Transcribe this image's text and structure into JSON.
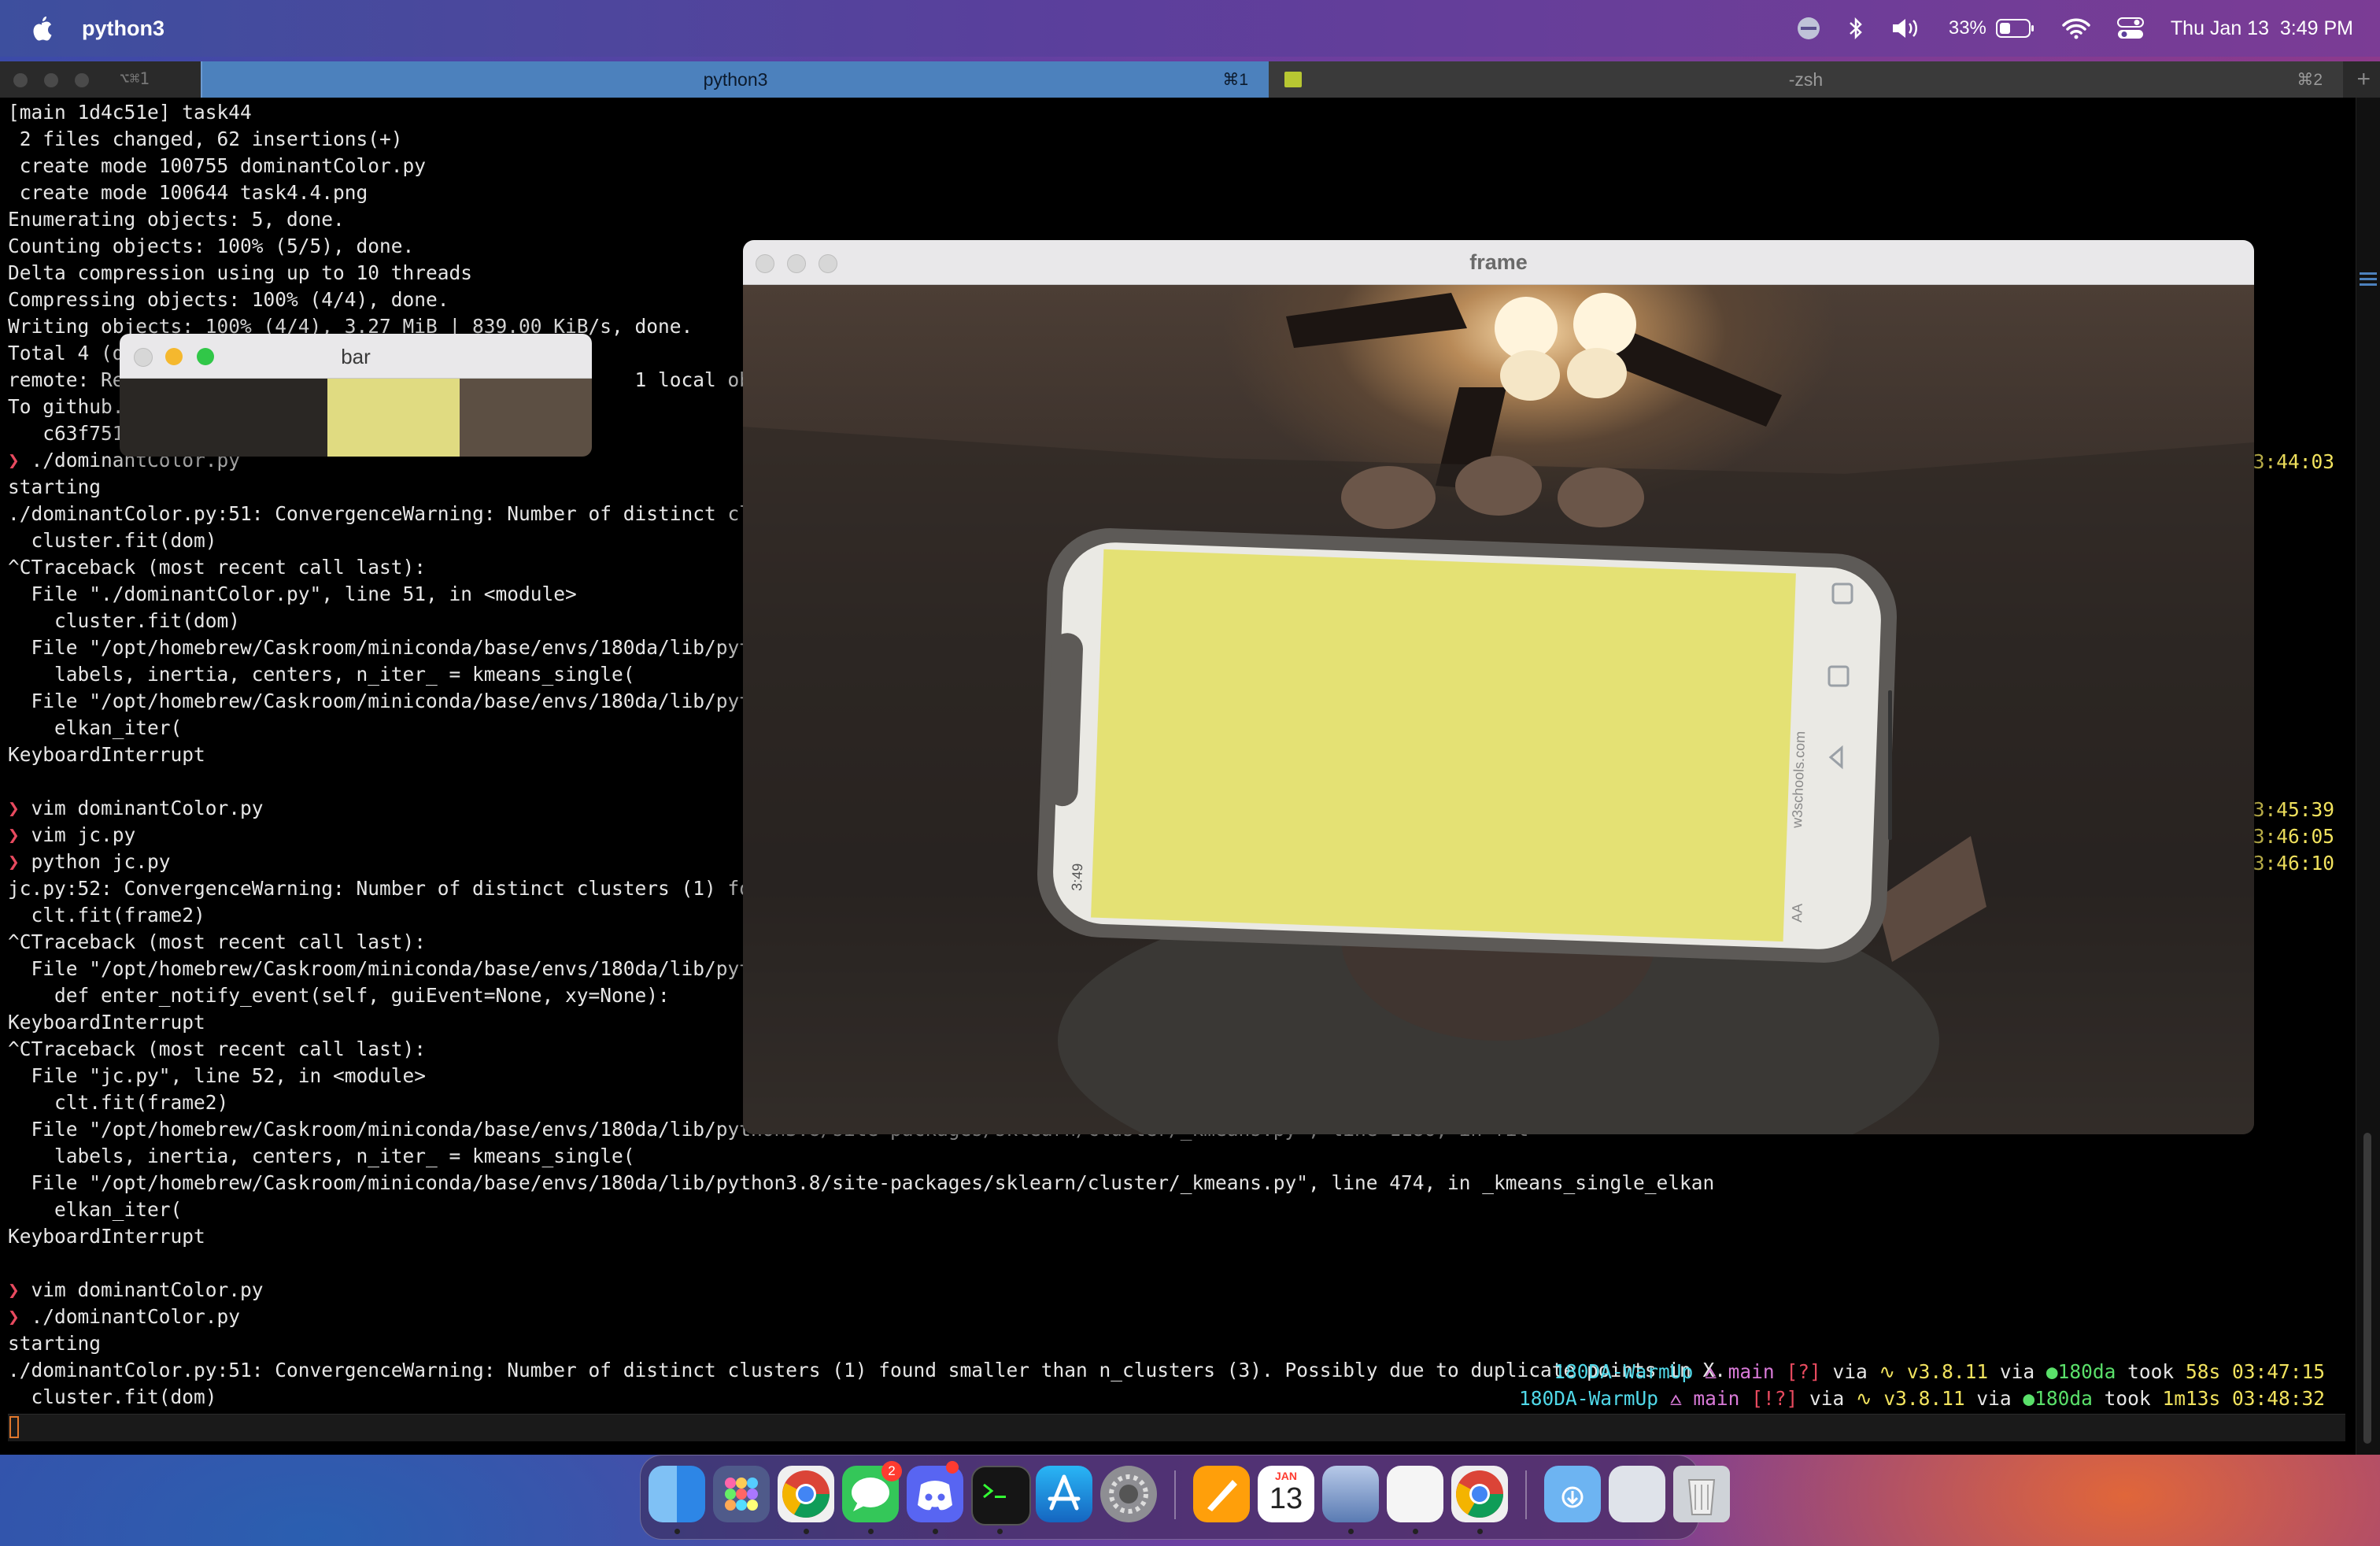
{
  "menubar": {
    "app_name": "python3",
    "battery": "33%",
    "datetime": "Thu Jan 13  3:49 PM"
  },
  "terminal": {
    "tabs": [
      {
        "label": "python3",
        "shortcut": "⌘1"
      },
      {
        "label": "-zsh",
        "shortcut": "⌘2"
      }
    ],
    "left_tab_label": "⌥⌘1",
    "lines": [
      "[main 1d4c51e] task44",
      " 2 files changed, 62 insertions(+)",
      " create mode 100755 dominantColor.py",
      " create mode 100644 task4.4.png",
      "Enumerating objects: 5, done.",
      "Counting objects: 100% (5/5), done.",
      "Delta compression using up to 10 threads",
      "Compressing objects: 100% (4/4), done.",
      "Writing objects: 100% (4/4), 3.27 MiB | 839.00 KiB/s, done.",
      "Total 4 (d",
      "remote: Re                                            1 local object",
      "To github.",
      "   c63f751",
      "❯ ./dominantColor.py",
      "starting",
      "./dominantColor.py:51: ConvergenceWarning: Number of distinct clust",
      "  cluster.fit(dom)",
      "^CTraceback (most recent call last):",
      "  File \"./dominantColor.py\", line 51, in <module>",
      "    cluster.fit(dom)",
      "  File \"/opt/homebrew/Caskroom/miniconda/base/envs/180da/lib/python",
      "    labels, inertia, centers, n_iter_ = kmeans_single(",
      "  File \"/opt/homebrew/Caskroom/miniconda/base/envs/180da/lib/python",
      "    elkan_iter(",
      "KeyboardInterrupt",
      "",
      "❯ vim dominantColor.py",
      "❯ vim jc.py",
      "❯ python jc.py",
      "jc.py:52: ConvergenceWarning: Number of distinct clusters (1) found",
      "  clt.fit(frame2)",
      "^CTraceback (most recent call last):",
      "  File \"/opt/homebrew/Caskroom/miniconda/base/envs/180da/lib/python",
      "    def enter_notify_event(self, guiEvent=None, xy=None):",
      "KeyboardInterrupt",
      "^CTraceback (most recent call last):",
      "  File \"jc.py\", line 52, in <module>",
      "    clt.fit(frame2)",
      "  File \"/opt/homebrew/Caskroom/miniconda/base/envs/180da/lib/python3.8/site-packages/sklearn/cluster/_kmeans.py\", line 1186, in fit",
      "    labels, inertia, centers, n_iter_ = kmeans_single(",
      "  File \"/opt/homebrew/Caskroom/miniconda/base/envs/180da/lib/python3.8/site-packages/sklearn/cluster/_kmeans.py\", line 474, in _kmeans_single_elkan",
      "    elkan_iter(",
      "KeyboardInterrupt",
      "",
      "❯ vim dominantColor.py",
      "❯ ./dominantColor.py",
      "starting",
      "./dominantColor.py:51: ConvergenceWarning: Number of distinct clusters (1) found smaller than n_clusters (3). Possibly due to duplicate points in X.",
      "  cluster.fit(dom)"
    ],
    "right_times": [
      "03:44:03",
      "03:45:39",
      "03:46:05",
      "03:46:10"
    ],
    "right_prompt_1": {
      "dir": "180DA-WarmUp",
      "branch": "main",
      "git": "[?]",
      "via1": "via",
      "python": "v3.8.11",
      "via2": "via",
      "env": "180da",
      "took": "took",
      "duration": "58s",
      "time": "03:47:15"
    },
    "right_prompt_2": {
      "dir": "180DA-WarmUp",
      "branch": "main",
      "git": "[!?]",
      "via1": "via",
      "python": "v3.8.11",
      "via2": "via",
      "env": "180da",
      "took": "took",
      "duration": "1m13s",
      "time": "03:48:32"
    }
  },
  "bar_window": {
    "title": "bar",
    "colors": [
      "#2a2724",
      "#e0db81",
      "#5c4f43"
    ],
    "widths": [
      0.44,
      0.28,
      0.28
    ]
  },
  "frame_window": {
    "title": "frame",
    "phone_screen_text": [
      "w3schools.com",
      "3:49",
      "AA"
    ]
  },
  "dock": {
    "calendar_month": "JAN",
    "calendar_day": "13",
    "messages_badge": "2"
  }
}
